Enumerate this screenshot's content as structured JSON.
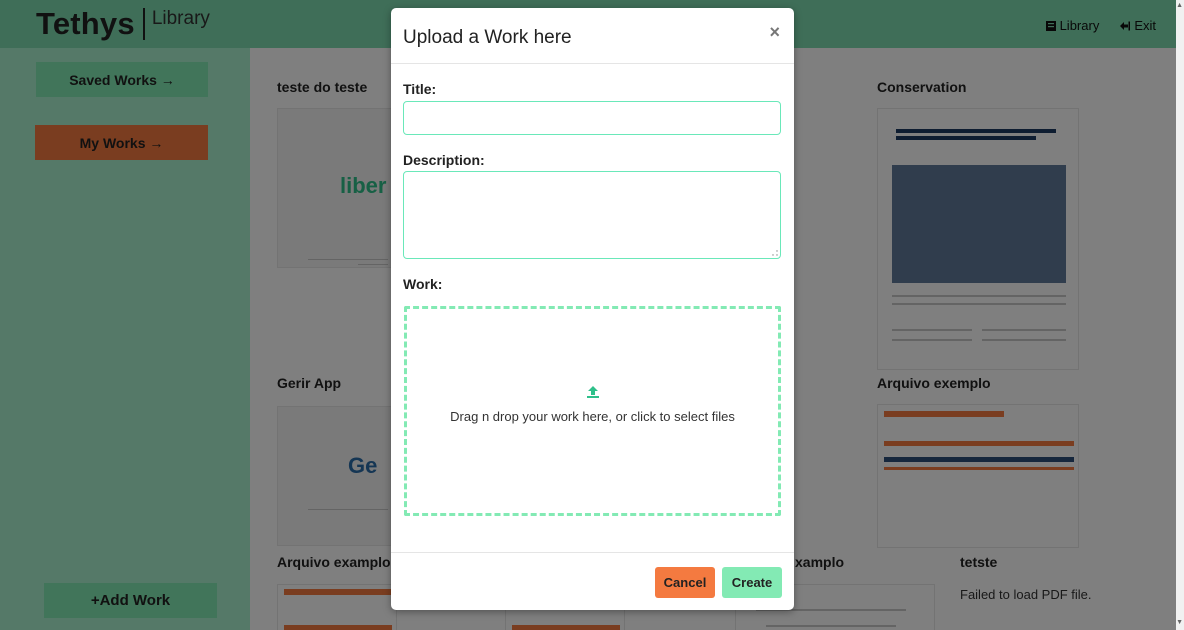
{
  "header": {
    "brand_main": "Tethys",
    "brand_sub": "Library",
    "nav_library": "Library",
    "nav_exit": "Exit"
  },
  "sidebar": {
    "saved_works": "Saved Works →",
    "my_works": "My Works →",
    "add_work": "+Add Work"
  },
  "cards": [
    {
      "title": "teste do teste",
      "logo": "liber"
    },
    {
      "title": "Conservation"
    },
    {
      "title": "Gerir App",
      "logo": "Ge"
    },
    {
      "title": "Arquivo exemplo"
    },
    {
      "title": "Arquivo examplo"
    },
    {
      "title": "xamplo"
    },
    {
      "title": "tetste",
      "status": "Failed to load PDF file."
    }
  ],
  "modal": {
    "title": "Upload a Work here",
    "close": "×",
    "title_label": "Title:",
    "title_value": "",
    "description_label": "Description:",
    "description_value": "",
    "work_label": "Work:",
    "dropzone_text": "Drag n drop your work here, or click to select files",
    "cancel": "Cancel",
    "create": "Create"
  },
  "colors": {
    "header": "#7fdcb0",
    "sidebar": "#abf3d1",
    "accent_green": "#83eab4",
    "accent_orange": "#f47a40"
  }
}
